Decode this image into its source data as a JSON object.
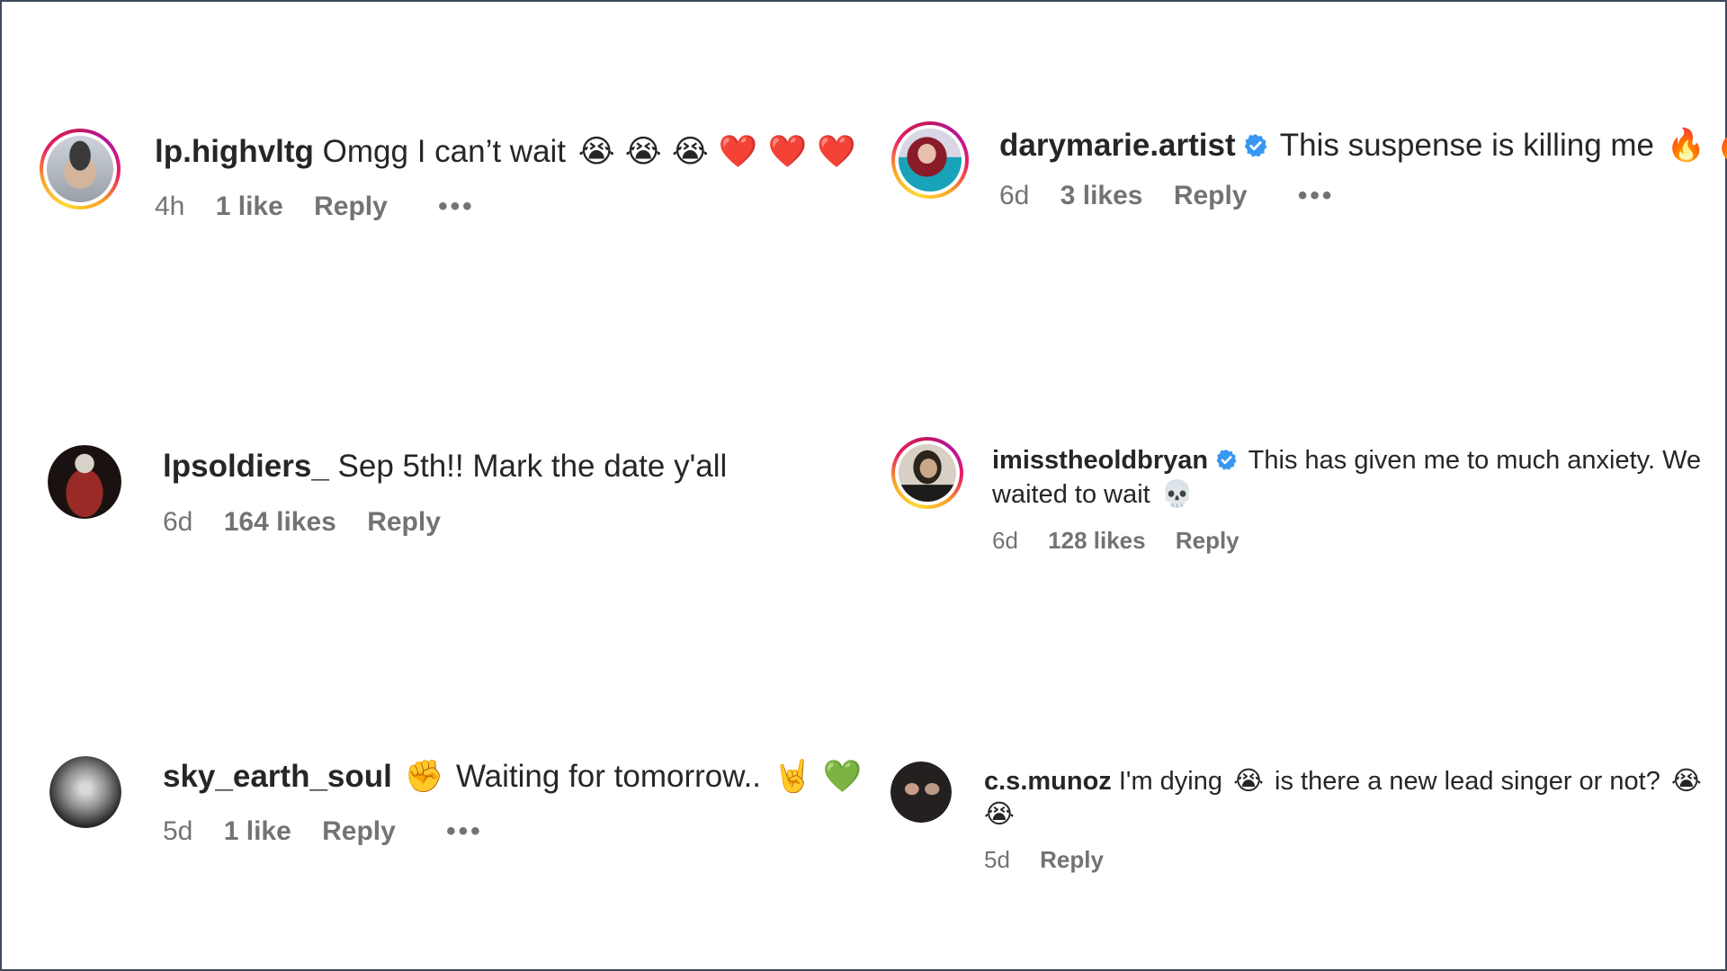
{
  "comments": [
    {
      "username": "lp.highvltg",
      "verified": false,
      "text": "Omgg I can’t wait",
      "emojis": "😭 😭 😭 ❤️ ❤️ ❤️",
      "time": "4h",
      "likes": "1 like",
      "reply_label": "Reply",
      "more_label": "•••",
      "story_ring": true
    },
    {
      "username": "darymarie.artist",
      "verified": true,
      "text": "This suspense is killing me",
      "emojis": "🔥 🔥 🔥",
      "time": "6d",
      "likes": "3 likes",
      "reply_label": "Reply",
      "more_label": "•••",
      "story_ring": true
    },
    {
      "username": "lpsoldiers_",
      "verified": false,
      "text": "Sep 5th!! Mark the date y'all",
      "emojis": "",
      "time": "6d",
      "likes": "164 likes",
      "reply_label": "Reply",
      "story_ring": false
    },
    {
      "username": "imisstheoldbryan",
      "verified": true,
      "text": "This has given me to much anxiety. We",
      "text_line2": "waited to wait",
      "emojis": "💀",
      "time": "6d",
      "likes": "128 likes",
      "reply_label": "Reply",
      "story_ring": true
    },
    {
      "username": "sky_earth_soul",
      "verified": false,
      "emoji_before": "✊",
      "text": "Waiting for tomorrow..",
      "emojis": "🤘 💚",
      "time": "5d",
      "likes": "1 like",
      "reply_label": "Reply",
      "more_label": "•••",
      "story_ring": false
    },
    {
      "username": "c.s.munoz",
      "verified": false,
      "text": "I'm dying",
      "emoji_mid": "😭",
      "text_after": "is there a new lead singer or not?",
      "emojis": "😭",
      "emoji_line2": "😭",
      "time": "5d",
      "reply_label": "Reply",
      "story_ring": false
    }
  ],
  "colors": {
    "verified_badge": "#3897f0",
    "meta_text": "#737373",
    "frame_border": "#3d4a5c"
  }
}
